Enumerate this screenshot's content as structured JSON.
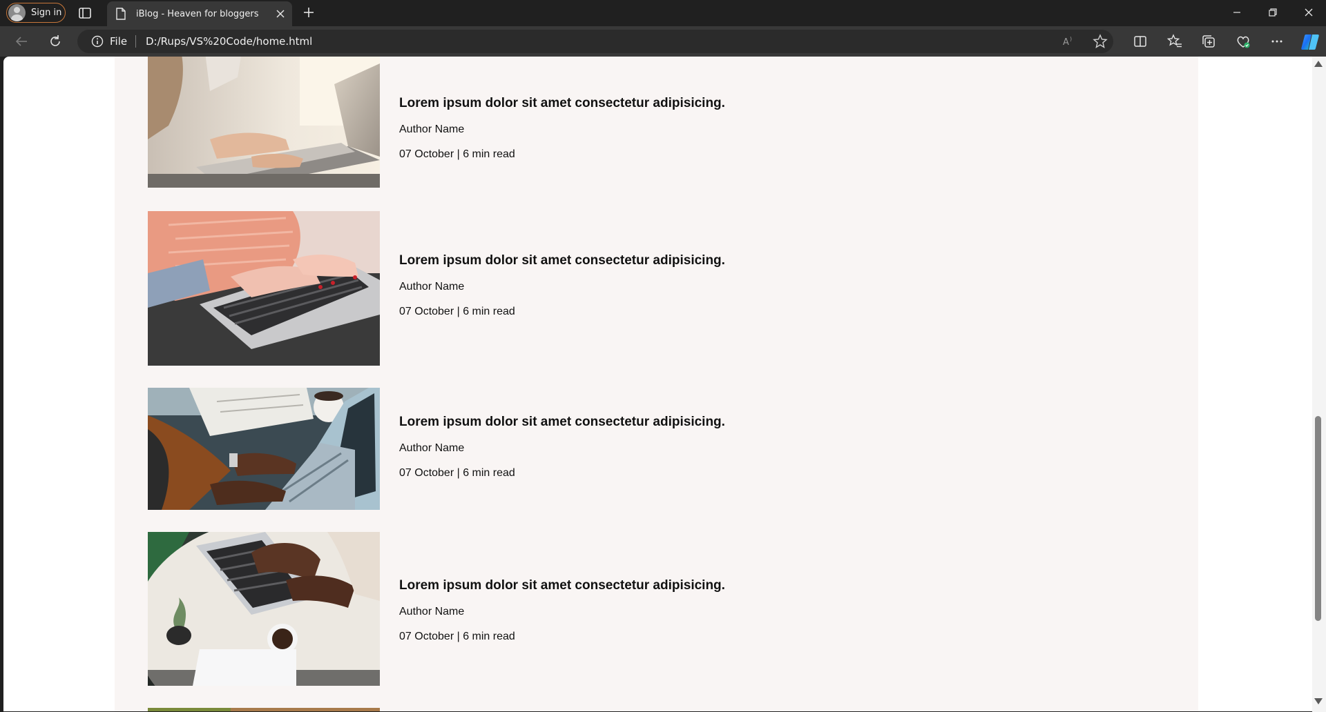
{
  "browser": {
    "signin_label": "Sign in",
    "tab_title": "iBlog - Heaven for bloggers",
    "address": {
      "scheme_label": "File",
      "url": "D:/Rups/VS%20Code/home.html"
    },
    "colors": {
      "accent": "#c8773a",
      "tab_bg": "#383838",
      "frame_bg": "#202020"
    }
  },
  "page": {
    "background": "#f9f5f4",
    "posts": [
      {
        "title": "Lorem ipsum dolor sit amet consectetur adipisicing.",
        "author": "Author Name",
        "meta": "07 October | 6 min read",
        "image": "woman typing on laptop by window"
      },
      {
        "title": "Lorem ipsum dolor sit amet consectetur adipisicing.",
        "author": "Author Name",
        "meta": "07 October | 6 min read",
        "image": "hands in pink sweater typing on laptop"
      },
      {
        "title": "Lorem ipsum dolor sit amet consectetur adipisicing.",
        "author": "Author Name",
        "meta": "07 October | 6 min read",
        "image": "hands typing on laptop with coffee mug"
      },
      {
        "title": "Lorem ipsum dolor sit amet consectetur adipisicing.",
        "author": "Author Name",
        "meta": "07 October | 6 min read",
        "image": "top view laptop on round table with coffee"
      }
    ]
  }
}
